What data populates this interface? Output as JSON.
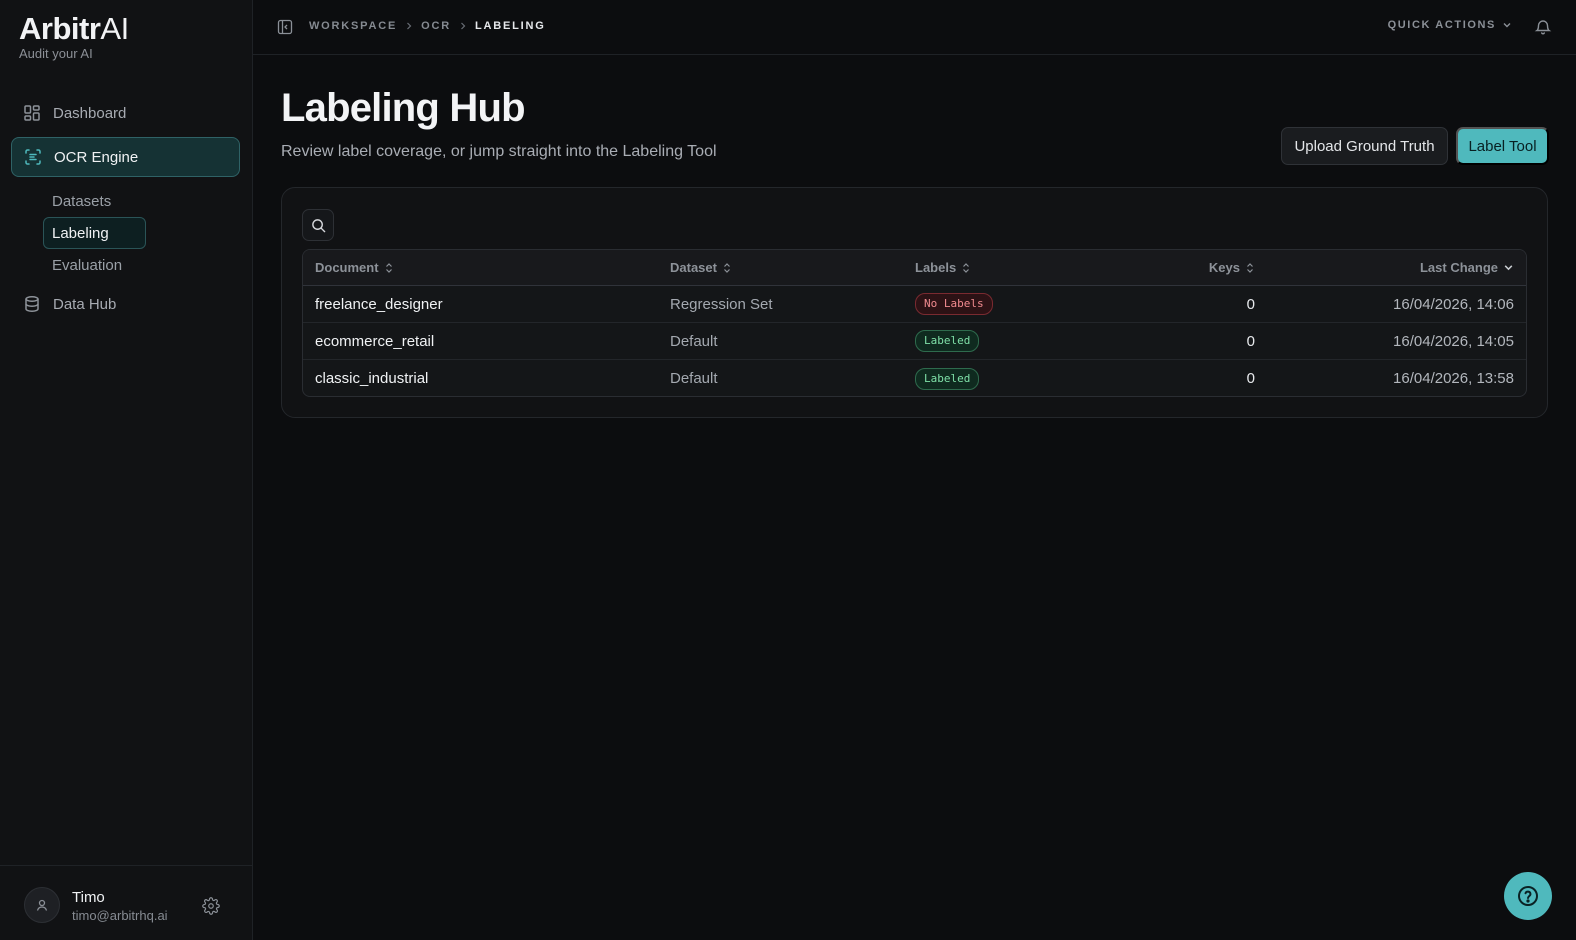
{
  "brand": {
    "name_bold": "Arbitr",
    "name_light": "AI",
    "tagline": "Audit your AI"
  },
  "sidebar": {
    "items": [
      {
        "label": "Dashboard",
        "icon": "dashboard-icon"
      },
      {
        "label": "OCR Engine",
        "icon": "scan-text-icon",
        "active": true
      },
      {
        "label": "Data Hub",
        "icon": "database-icon"
      }
    ],
    "sub_items": [
      {
        "label": "Datasets"
      },
      {
        "label": "Labeling",
        "active": true
      },
      {
        "label": "Evaluation"
      }
    ]
  },
  "user": {
    "name": "Timo",
    "email": "timo@arbitrhq.ai"
  },
  "topbar": {
    "breadcrumbs": [
      "WORKSPACE",
      "OCR",
      "LABELING"
    ],
    "quick_actions": "QUICK ACTIONS"
  },
  "page": {
    "title": "Labeling Hub",
    "subtitle": "Review label coverage, or jump straight into the Labeling Tool",
    "upload_button": "Upload Ground Truth",
    "label_tool_button": "Label Tool"
  },
  "table": {
    "columns": [
      "Document",
      "Dataset",
      "Labels",
      "Keys",
      "Last Change"
    ],
    "rows": [
      {
        "document": "freelance_designer",
        "dataset": "Regression Set",
        "labels": "No Labels",
        "keys": "0",
        "last_change": "16/04/2026, 14:06"
      },
      {
        "document": "ecommerce_retail",
        "dataset": "Default",
        "labels": "Labeled",
        "keys": "0",
        "last_change": "16/04/2026, 14:05"
      },
      {
        "document": "classic_industrial",
        "dataset": "Default",
        "labels": "Labeled",
        "keys": "0",
        "last_change": "16/04/2026, 13:58"
      }
    ]
  },
  "colors": {
    "accent": "#4fb9bd",
    "background": "#0c0d0f",
    "sidebar": "#111214",
    "badge_red": "#f08a8f",
    "badge_green": "#7fe0a8"
  }
}
